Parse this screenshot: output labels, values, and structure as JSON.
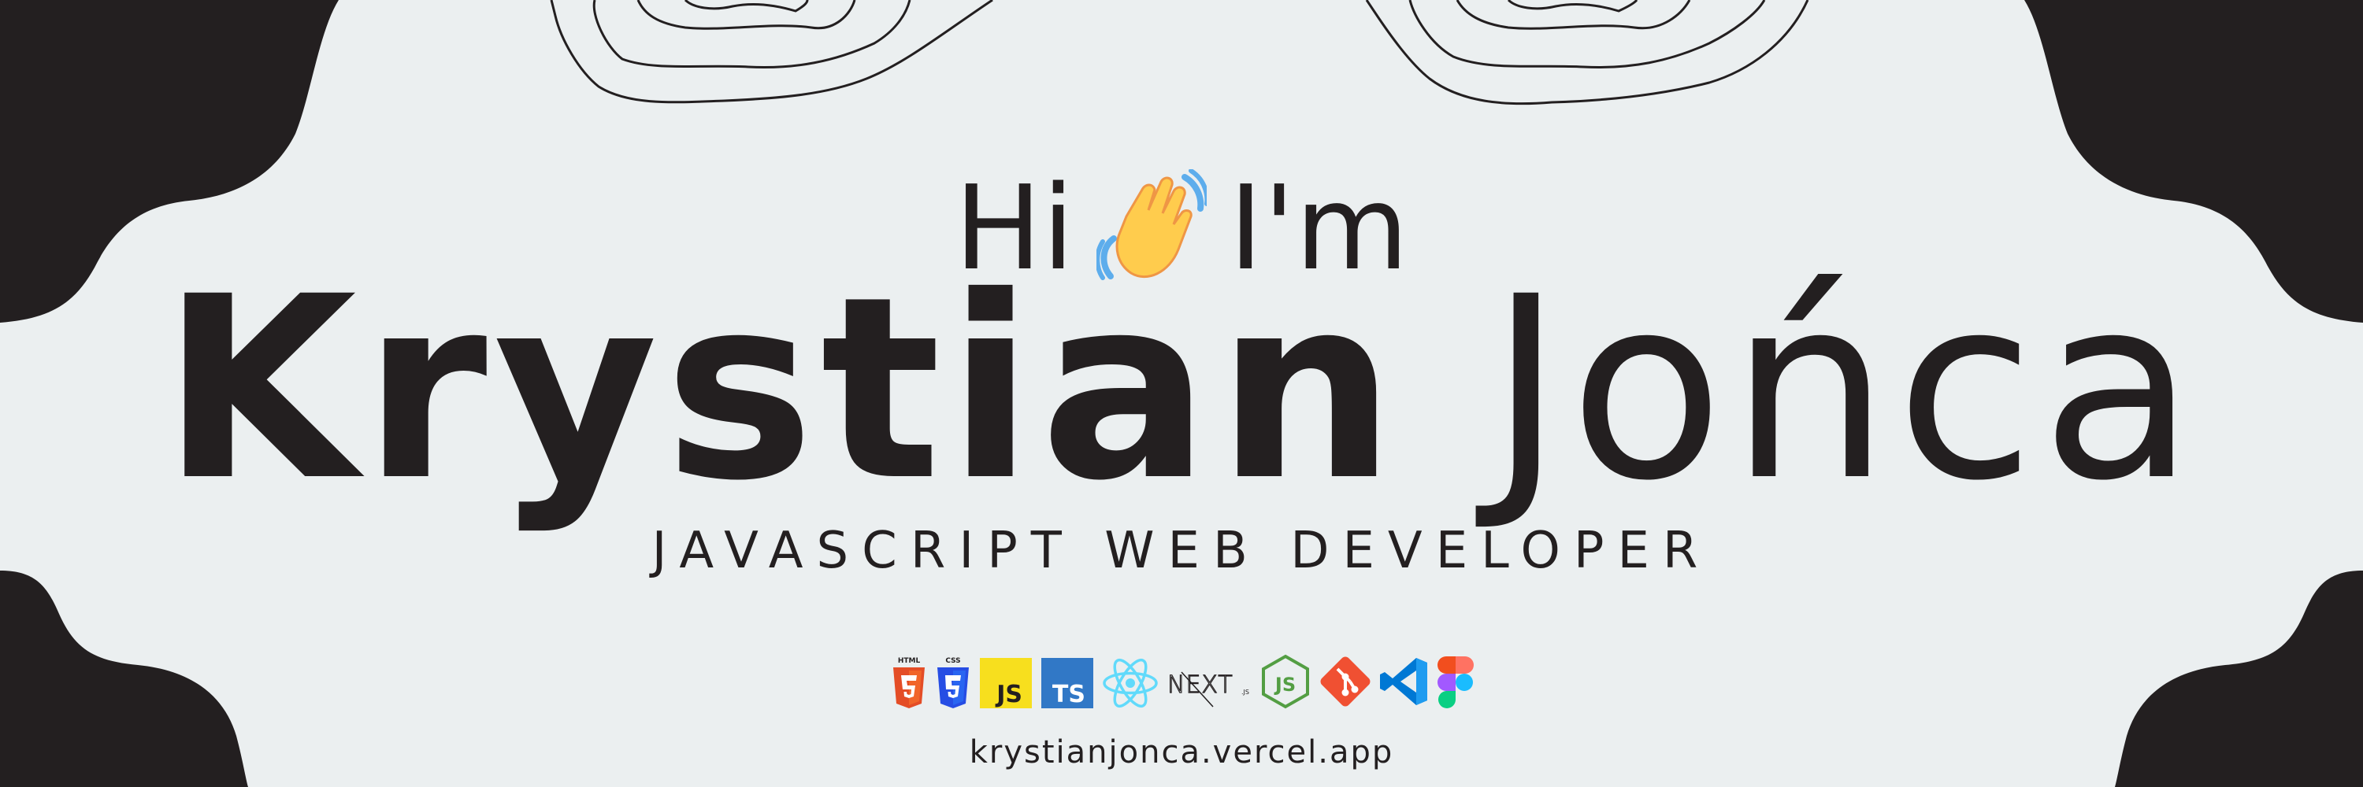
{
  "greeting": {
    "hi": "Hi",
    "im": "I'm",
    "emoji": "waving-hand-icon"
  },
  "name": {
    "first": "Krystian",
    "last": "Jońca"
  },
  "role": "JAVASCRIPT WEB DEVELOPER",
  "tech_icons": {
    "html": "HTML",
    "css": "CSS",
    "js": "JS",
    "ts": "TS",
    "next": "NEXT",
    "next_sub": ".JS",
    "node": "JS"
  },
  "url": "krystianjonca.vercel.app",
  "colors": {
    "background": "#EBEFF0",
    "dark": "#231F20",
    "html5": "#E44D26",
    "css3": "#264DE4",
    "javascript": "#F7DF1E",
    "typescript": "#3178C6",
    "react": "#61DAFB",
    "node": "#539E43",
    "git": "#F05032",
    "vscode": "#0078D4"
  }
}
